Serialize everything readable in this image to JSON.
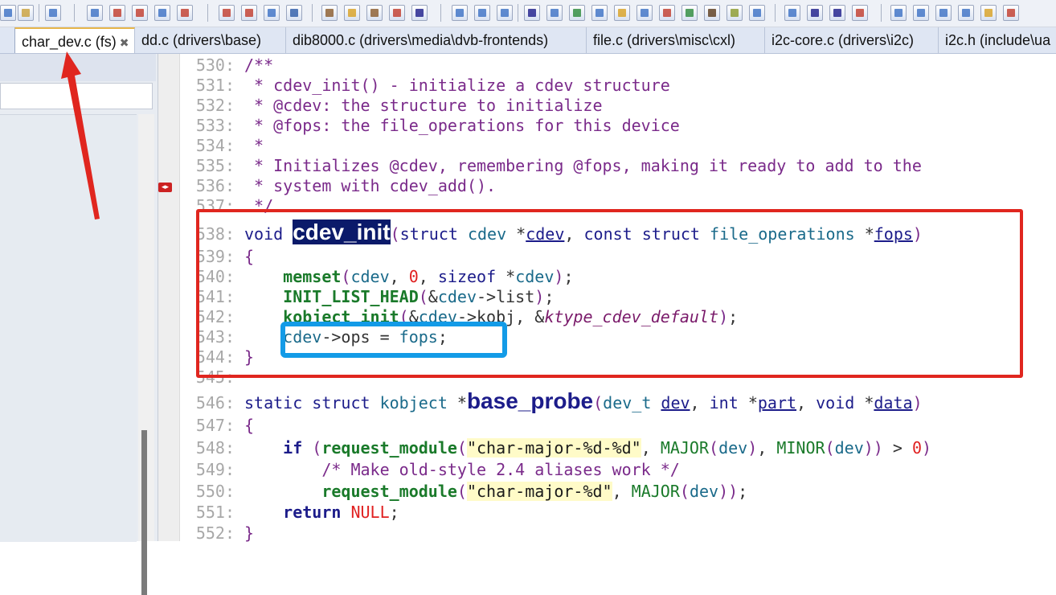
{
  "tabs": [
    {
      "label": "char_dev.c (fs)",
      "close": "✖",
      "active": true
    },
    {
      "label": "dd.c (drivers\\base)"
    },
    {
      "label": "dib8000.c (drivers\\media\\dvb-frontends)"
    },
    {
      "label": "file.c (drivers\\misc\\cxl)"
    },
    {
      "label": "i2c-core.c (drivers\\i2c)"
    },
    {
      "label": "i2c.h (include\\ua"
    }
  ],
  "code": {
    "lines": [
      {
        "n": "530:"
      },
      {
        "n": "531:"
      },
      {
        "n": "532:"
      },
      {
        "n": "533:"
      },
      {
        "n": "534:"
      },
      {
        "n": "535:"
      },
      {
        "n": "536:"
      },
      {
        "n": "537:"
      },
      {
        "n": "538:"
      },
      {
        "n": "539:"
      },
      {
        "n": "540:"
      },
      {
        "n": "541:"
      },
      {
        "n": "542:"
      },
      {
        "n": "543:"
      },
      {
        "n": "544:"
      },
      {
        "n": "545:"
      },
      {
        "n": "546:"
      },
      {
        "n": "547:"
      },
      {
        "n": "548:"
      },
      {
        "n": "549:"
      },
      {
        "n": "550:"
      },
      {
        "n": "551:"
      },
      {
        "n": "552:"
      }
    ]
  },
  "colors": {
    "annotation_red": "#e0261f",
    "annotation_blue": "#139be7",
    "selection": "#0b1a6a"
  }
}
